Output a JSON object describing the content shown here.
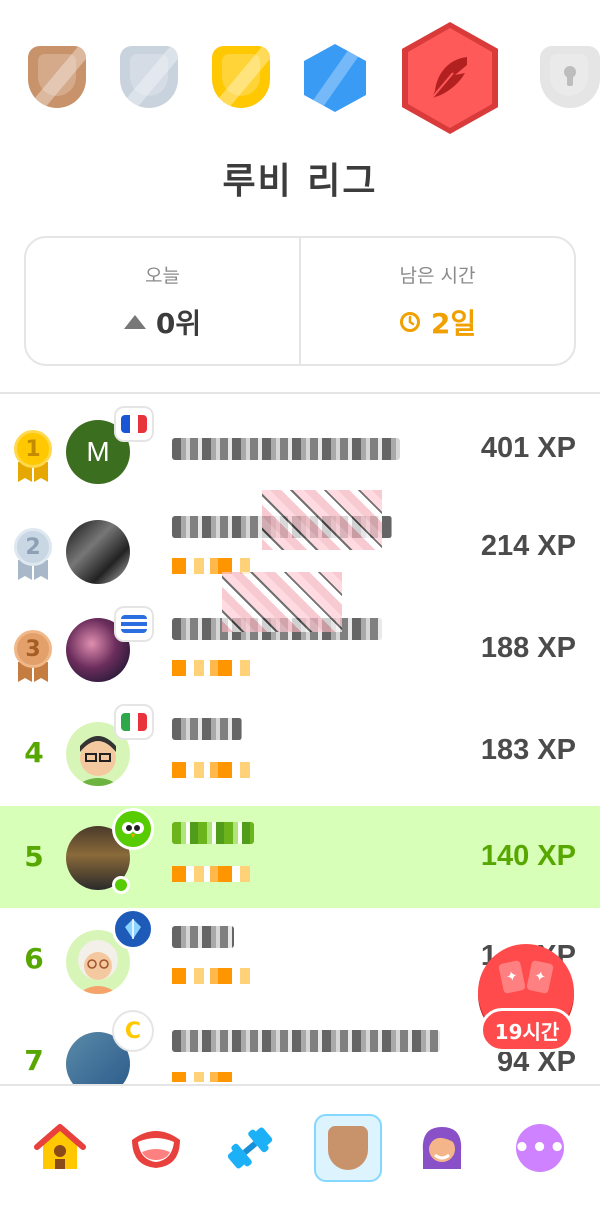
{
  "league": {
    "title": "루비 리그",
    "badges": [
      "bronze-league-badge",
      "silver-league-badge",
      "gold-league-badge",
      "sapphire-league-badge",
      "ruby-league-badge",
      "locked-league-badge"
    ]
  },
  "stats": {
    "today_label": "오늘",
    "today_value": "0위",
    "remaining_label": "남은 시간",
    "remaining_value": "2일"
  },
  "leaderboard": [
    {
      "rank": "1",
      "xp": "401 XP",
      "flag": "france",
      "medal": "gold"
    },
    {
      "rank": "2",
      "xp": "214 XP",
      "medal": "silver"
    },
    {
      "rank": "3",
      "xp": "188 XP",
      "flag": "greece",
      "medal": "bronze"
    },
    {
      "rank": "4",
      "xp": "183 XP",
      "flag": "italy"
    },
    {
      "rank": "5",
      "xp": "140 XP",
      "highlight": true
    },
    {
      "rank": "6",
      "xp": "1__ XP"
    },
    {
      "rank": "7",
      "xp": "94 XP"
    }
  ],
  "floating": {
    "timer_label": "19시간"
  },
  "colors": {
    "accent_green": "#58cc02",
    "highlight_bg": "#d7ffb8",
    "ruby": "#ff5a5a",
    "orange": "#f0a000"
  },
  "nav": {
    "items": [
      "home-icon",
      "speak-icon",
      "practice-dumbbell-icon",
      "league-shield-icon",
      "profile-avatar-icon",
      "more-icon"
    ],
    "more_label": "•••"
  },
  "avatars": {
    "row1_initial": "M"
  }
}
